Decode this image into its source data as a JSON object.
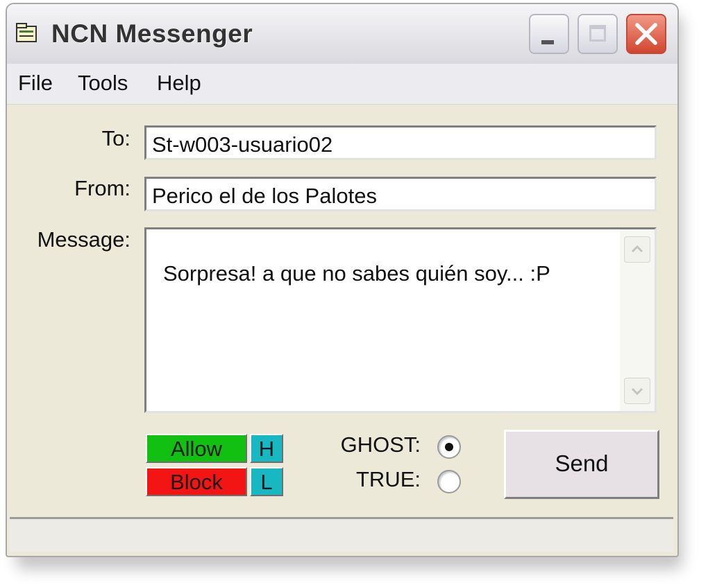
{
  "window": {
    "title": "NCN Messenger"
  },
  "menu": {
    "items": [
      {
        "label": "File"
      },
      {
        "label": "Tools"
      },
      {
        "label": "Help"
      }
    ]
  },
  "form": {
    "to_label": "To:",
    "to_value": "St-w003-usuario02",
    "from_label": "From:",
    "from_value": "Perico el de los Palotes",
    "message_label": "Message:",
    "message_value": "Sorpresa! a que no sabes quién soy... :P"
  },
  "controls": {
    "allow_label": "Allow",
    "block_label": "Block",
    "h_label": "H",
    "l_label": "L",
    "ghost_label": "GHOST:",
    "true_label": "TRUE:",
    "selected_mode": "GHOST",
    "send_label": "Send"
  },
  "colors": {
    "allow": "#12c012",
    "block": "#f31414",
    "hl": "#17b8c2",
    "close_button": "#d2452f"
  },
  "icons": {
    "app": "folder-window-icon",
    "minimize": "minimize-icon",
    "maximize": "maximize-icon",
    "close": "close-icon",
    "scroll_up": "chevron-up-icon",
    "scroll_down": "chevron-down-icon"
  }
}
